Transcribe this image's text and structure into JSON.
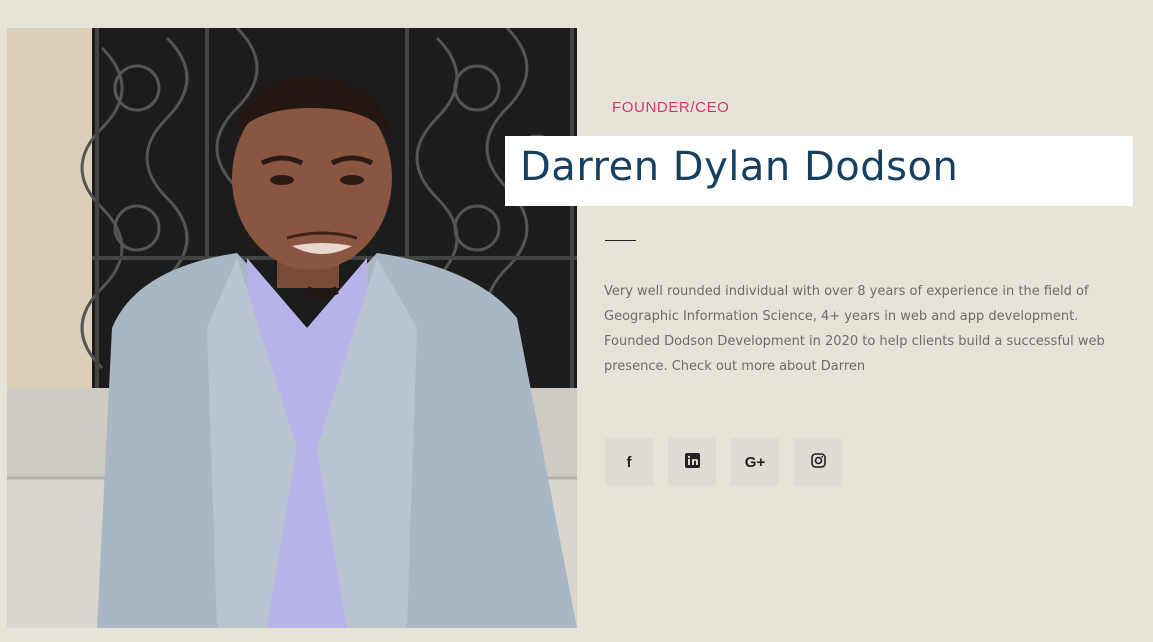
{
  "profile": {
    "role": "FOUNDER/CEO",
    "name": "Darren Dylan Dodson",
    "bio": "Very well rounded individual with over 8 years of experience in the field of Geographic Information Science, 4+ years in web and app development. Founded Dodson Development in 2020 to help clients build a successful web presence. Check out more about Darren"
  },
  "socials": [
    {
      "icon": "facebook-icon",
      "glyph": "f"
    },
    {
      "icon": "linkedin-icon",
      "glyph": "in"
    },
    {
      "icon": "google-plus-icon",
      "glyph": "G+"
    },
    {
      "icon": "instagram-icon",
      "glyph": ""
    }
  ],
  "colors": {
    "background": "#e8e3d9",
    "role": "#d63768",
    "name": "#173f5f",
    "bio": "#6b6b6b",
    "social_bg": "#e0dcd3"
  }
}
